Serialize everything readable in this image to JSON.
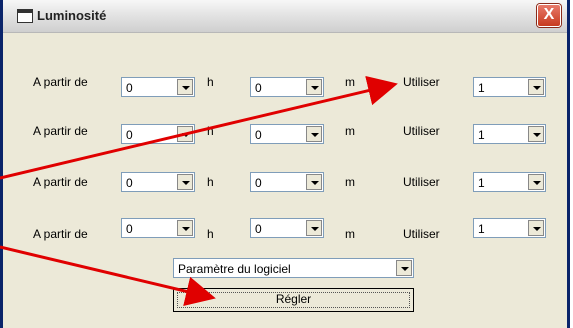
{
  "window": {
    "title": "Luminosité",
    "close_label": "X"
  },
  "rows": [
    {
      "label": "A partir de",
      "hour": "0",
      "h_unit": "h",
      "minute": "0",
      "m_unit": "m",
      "use_label": "Utiliser",
      "use_value": "1"
    },
    {
      "label": "A partir de",
      "hour": "0",
      "h_unit": "h",
      "minute": "0",
      "m_unit": "m",
      "use_label": "Utiliser",
      "use_value": "1"
    },
    {
      "label": "A partir de",
      "hour": "0",
      "h_unit": "h",
      "minute": "0",
      "m_unit": "m",
      "use_label": "Utiliser",
      "use_value": "1"
    },
    {
      "label": "A partir de",
      "hour": "0",
      "h_unit": "h",
      "minute": "0",
      "m_unit": "m",
      "use_label": "Utiliser",
      "use_value": "1"
    }
  ],
  "settings_select": {
    "value": "Paramètre du logiciel"
  },
  "apply_button": {
    "label": "Régler"
  },
  "colors": {
    "arrow": "#e00000",
    "titlebar": "#e4e4e4",
    "dialog": "#ece9d8"
  }
}
